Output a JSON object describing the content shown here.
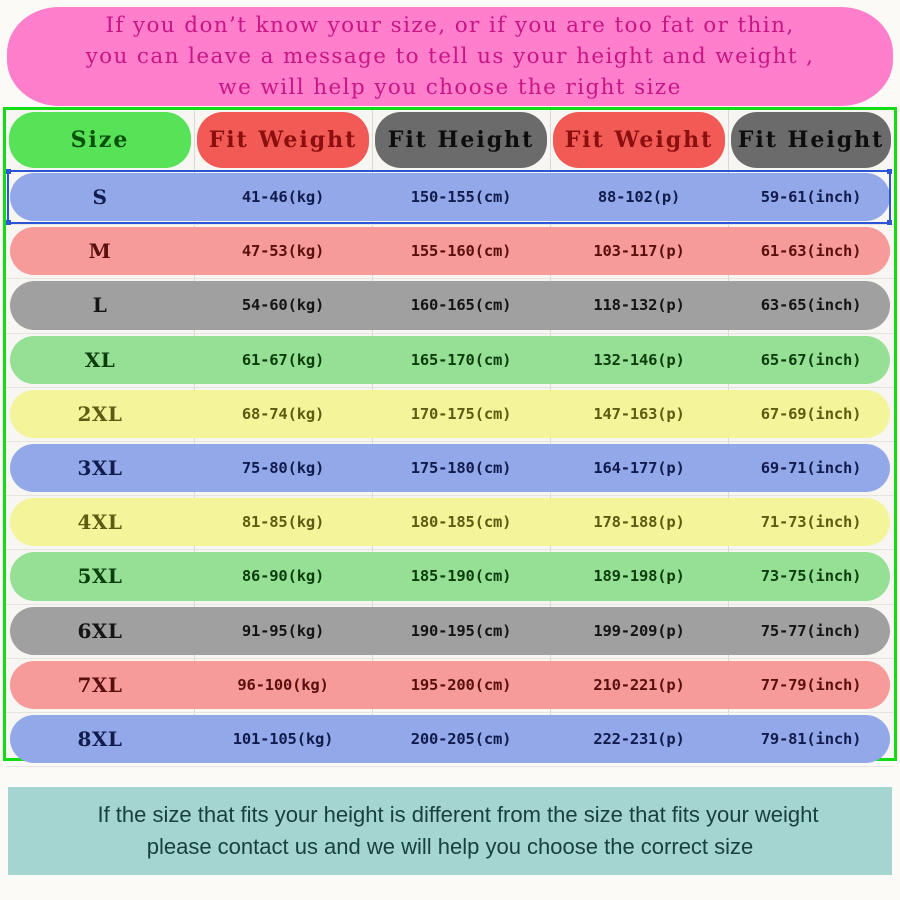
{
  "notice": {
    "lines": [
      "If you don’t know your size, or if you are too fat or thin,",
      "you can leave a message to tell us your height and weight ,",
      "we will help you choose the right size"
    ],
    "background_color": "#ff7fcd",
    "text_color": "#c71585"
  },
  "footer": {
    "lines": [
      "If the size that fits your height is different from the size that fits your weight",
      "please contact us and we will help you choose the correct size"
    ],
    "background_color": "#a5d5d1",
    "text_color": "#17403f"
  },
  "table": {
    "frame_color": "#12dd12",
    "selected_row": "S",
    "selection_color": "#2b55d6",
    "headers": [
      {
        "label": "Size",
        "pill_color": "#57e257",
        "text_color": "#0b4f0b"
      },
      {
        "label": "Fit Weight",
        "pill_color": "#f25a56",
        "text_color": "#8b0f0f"
      },
      {
        "label": "Fit Height",
        "pill_color": "#6b6b6b",
        "text_color": "#0d0d0d"
      },
      {
        "label": "Fit Weight",
        "pill_color": "#f25a56",
        "text_color": "#8b0f0f"
      },
      {
        "label": "Fit Height",
        "pill_color": "#6b6b6b",
        "text_color": "#0d0d0d"
      }
    ],
    "columns": [
      "Size",
      "Fit Weight",
      "Fit Height",
      "Fit Weight",
      "Fit Height"
    ],
    "rows": [
      {
        "size": "S",
        "fit_weight_kg": "41-46(kg)",
        "fit_height_cm": "150-155(cm)",
        "fit_weight_lb": "88-102(p)",
        "fit_height_in": "59-61(inch)",
        "band_color": "#92a8e8",
        "text_color": "#111b4d"
      },
      {
        "size": "M",
        "fit_weight_kg": "47-53(kg)",
        "fit_height_cm": "155-160(cm)",
        "fit_weight_lb": "103-117(p)",
        "fit_height_in": "61-63(inch)",
        "band_color": "#f79a9a",
        "text_color": "#5a0f0f"
      },
      {
        "size": "L",
        "fit_weight_kg": "54-60(kg)",
        "fit_height_cm": "160-165(cm)",
        "fit_weight_lb": "118-132(p)",
        "fit_height_in": "63-65(inch)",
        "band_color": "#a0a0a0",
        "text_color": "#141414"
      },
      {
        "size": "XL",
        "fit_weight_kg": "61-67(kg)",
        "fit_height_cm": "165-170(cm)",
        "fit_weight_lb": "132-146(p)",
        "fit_height_in": "65-67(inch)",
        "band_color": "#96e096",
        "text_color": "#0c3d0c"
      },
      {
        "size": "2XL",
        "fit_weight_kg": "68-74(kg)",
        "fit_height_cm": "170-175(cm)",
        "fit_weight_lb": "147-163(p)",
        "fit_height_in": "67-69(inch)",
        "band_color": "#f4f49a",
        "text_color": "#5c5c12"
      },
      {
        "size": "3XL",
        "fit_weight_kg": "75-80(kg)",
        "fit_height_cm": "175-180(cm)",
        "fit_weight_lb": "164-177(p)",
        "fit_height_in": "69-71(inch)",
        "band_color": "#92a8e8",
        "text_color": "#111b4d"
      },
      {
        "size": "4XL",
        "fit_weight_kg": "81-85(kg)",
        "fit_height_cm": "180-185(cm)",
        "fit_weight_lb": "178-188(p)",
        "fit_height_in": "71-73(inch)",
        "band_color": "#f4f49a",
        "text_color": "#5c5c12"
      },
      {
        "size": "5XL",
        "fit_weight_kg": "86-90(kg)",
        "fit_height_cm": "185-190(cm)",
        "fit_weight_lb": "189-198(p)",
        "fit_height_in": "73-75(inch)",
        "band_color": "#96e096",
        "text_color": "#0c3d0c"
      },
      {
        "size": "6XL",
        "fit_weight_kg": "91-95(kg)",
        "fit_height_cm": "190-195(cm)",
        "fit_weight_lb": "199-209(p)",
        "fit_height_in": "75-77(inch)",
        "band_color": "#a0a0a0",
        "text_color": "#141414"
      },
      {
        "size": "7XL",
        "fit_weight_kg": "96-100(kg)",
        "fit_height_cm": "195-200(cm)",
        "fit_weight_lb": "210-221(p)",
        "fit_height_in": "77-79(inch)",
        "band_color": "#f79a9a",
        "text_color": "#5a0f0f"
      },
      {
        "size": "8XL",
        "fit_weight_kg": "101-105(kg)",
        "fit_height_cm": "200-205(cm)",
        "fit_weight_lb": "222-231(p)",
        "fit_height_in": "79-81(inch)",
        "band_color": "#92a8e8",
        "text_color": "#111b4d"
      }
    ]
  }
}
